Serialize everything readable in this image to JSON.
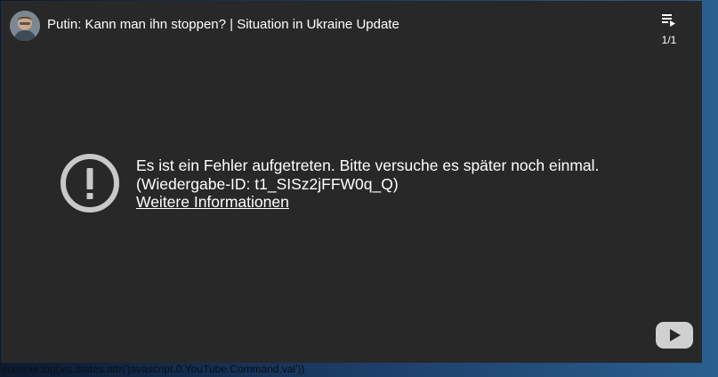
{
  "video": {
    "title": "Putin: Kann man ihn stoppen? | Situation in Ukraine Update",
    "avatar_icon": "channel-avatar",
    "playlist_icon": "playlist-icon",
    "playlist_count": "1/1"
  },
  "error": {
    "icon": "exclamation-circle-icon",
    "message": "Es ist ein Fehler aufgetreten. Bitte versuche es später noch einmal.",
    "playback_id": "(Wiedergabe-ID: t1_SISz2jFFW0q_Q)",
    "more_info_link": "Weitere Informationen"
  },
  "logo": {
    "icon": "youtube-logo-icon"
  },
  "console": {
    "text": "console.log(vis.states.attr('javascript.0.YouTube.Command.val'))"
  },
  "colors": {
    "player_bg": "#282828",
    "text": "#ffffff",
    "icon_gray": "#c8c8c8",
    "page_bg_left": "#0d1a2e",
    "page_bg_right": "#2b5f8f"
  }
}
